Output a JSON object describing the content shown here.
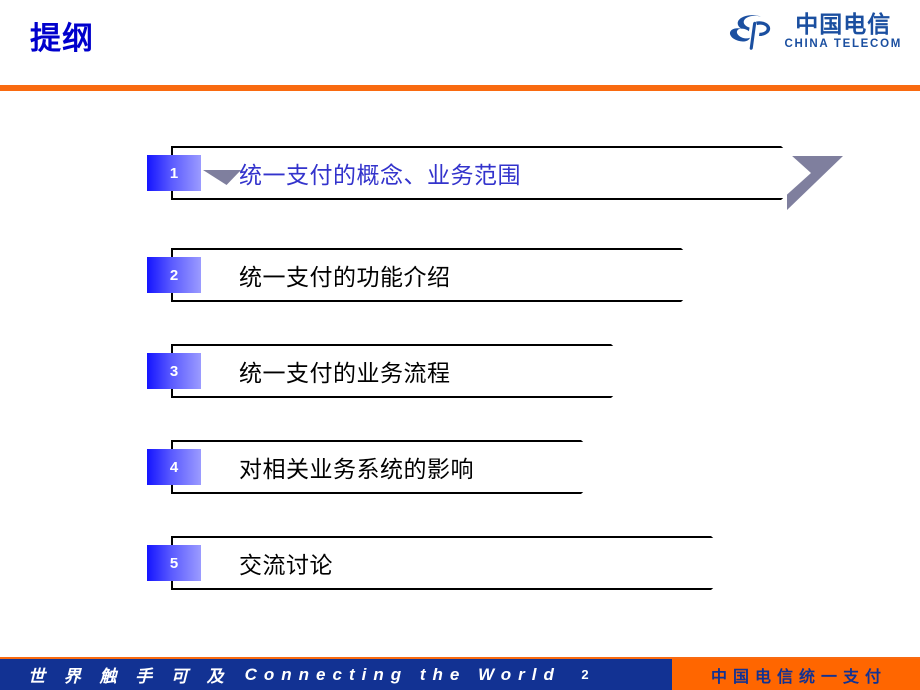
{
  "slide": {
    "title": "提纲",
    "page_number": "2",
    "accent_orange": "#f96a10",
    "accent_blue": "#123293",
    "title_color": "#0000cc",
    "active_text_color": "#3333cc"
  },
  "logo": {
    "icon_name": "china-telecom-swirl-logo",
    "cn_name": "中国电信",
    "en_name": "CHINA TELECOM",
    "color": "#1b4fa0"
  },
  "agenda": {
    "items": [
      {
        "number": "1",
        "label": "统一支付的概念、业务范围",
        "active": true
      },
      {
        "number": "2",
        "label": "统一支付的功能介绍",
        "active": false
      },
      {
        "number": "3",
        "label": "统一支付的业务流程",
        "active": false
      },
      {
        "number": "4",
        "label": "对相关业务系统的影响",
        "active": false
      },
      {
        "number": "5",
        "label": "交流讨论",
        "active": false
      }
    ]
  },
  "footer": {
    "slogan_cn": "世 界 触 手 可 及",
    "slogan_en": "Connecting  the  World",
    "product_name": "中国电信统一支付"
  }
}
